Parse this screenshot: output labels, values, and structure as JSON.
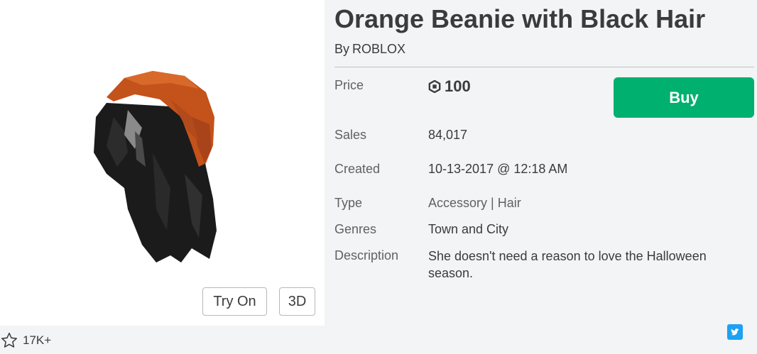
{
  "item": {
    "title": "Orange Beanie with Black Hair",
    "by_label": "By",
    "creator": "ROBLOX",
    "image_alt": "orange-beanie-black-hair-render"
  },
  "preview": {
    "try_on_label": "Try On",
    "view_3d_label": "3D"
  },
  "favorites": {
    "icon": "star-outline-icon",
    "count": "17K+"
  },
  "details": {
    "price_label": "Price",
    "price_icon": "robux-icon",
    "price_value": "100",
    "buy_label": "Buy",
    "sales_label": "Sales",
    "sales_value": "84,017",
    "created_label": "Created",
    "created_value": "10-13-2017 @ 12:18 AM",
    "type_label": "Type",
    "type_value": "Accessory | Hair",
    "genres_label": "Genres",
    "genres_value": "Town and City",
    "description_label": "Description",
    "description_value": "She doesn't need a reason to love the Halloween season."
  },
  "share": {
    "icon": "twitter-icon"
  },
  "colors": {
    "buy_button": "#00b06f",
    "page_background": "#f2f4f5",
    "twitter": "#1da1f2"
  }
}
